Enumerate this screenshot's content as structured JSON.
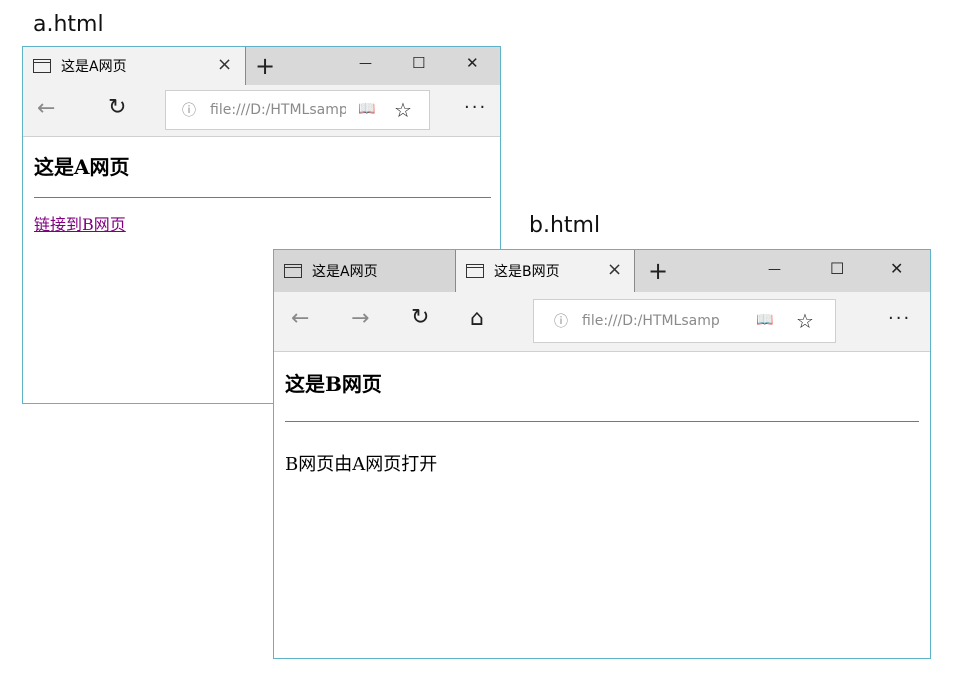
{
  "captions": {
    "a": "a.html",
    "b": "b.html"
  },
  "window_a": {
    "tab": {
      "title": "这是A网页",
      "close": "×"
    },
    "newtab": "+",
    "controls": {
      "minimize": "—",
      "maximize": "☐",
      "close": "✕"
    },
    "nav": {
      "back": "←",
      "refresh": "↻"
    },
    "address": {
      "info": "ⓘ",
      "url": "file:///D:/HTMLsamp",
      "reading": "📖",
      "favorite": "☆"
    },
    "more": "···",
    "page": {
      "heading": "这是A网页",
      "link": "链接到B网页"
    }
  },
  "window_b": {
    "tabs": [
      {
        "title": "这是A网页"
      },
      {
        "title": "这是B网页",
        "close": "×"
      }
    ],
    "newtab": "+",
    "controls": {
      "minimize": "—",
      "maximize": "☐",
      "close": "✕"
    },
    "nav": {
      "back": "←",
      "forward": "→",
      "refresh": "↻",
      "home": "⌂"
    },
    "address": {
      "info": "ⓘ",
      "url": "file:///D:/HTMLsamp",
      "reading": "📖",
      "favorite": "☆"
    },
    "more": "···",
    "page": {
      "heading": "这是B网页",
      "paragraph": "B网页由A网页打开"
    }
  }
}
